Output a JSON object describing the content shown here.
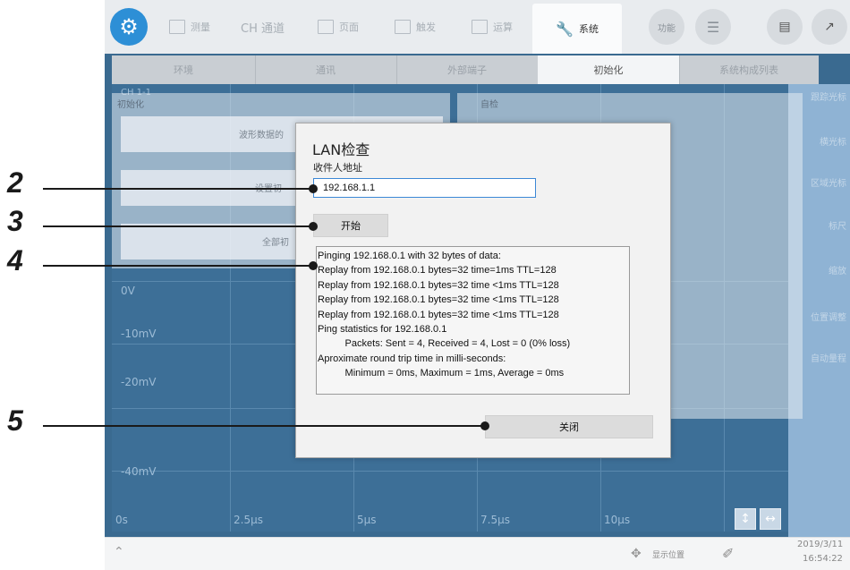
{
  "topbar": {
    "tabs": [
      {
        "label": "测量",
        "icon": "waveform-icon"
      },
      {
        "label": "CH 通道",
        "icon": ""
      },
      {
        "label": "页面",
        "icon": "page-icon"
      },
      {
        "label": "触发",
        "icon": "trigger-icon"
      },
      {
        "label": "运算",
        "icon": "calc-icon"
      }
    ],
    "system_tab": {
      "label": "系统",
      "icon": "wrench-icon"
    },
    "func_button": "功能"
  },
  "subtabs": [
    "环境",
    "通讯",
    "外部端子",
    "初始化",
    "系统构成列表"
  ],
  "graph": {
    "ch_label": "CH 1-1",
    "y_labels": [
      "0V",
      "-10mV",
      "-20mV",
      "-40mV"
    ],
    "x_labels": [
      "0s",
      "2.5μs",
      "5μs",
      "7.5μs",
      "10μs"
    ]
  },
  "right_panel": [
    "跟踪光标",
    "横光标",
    "区域光标",
    "标尺",
    "缩放",
    "位置调整",
    "自动量程"
  ],
  "background_panels": {
    "init_title": "初始化",
    "self_check_title": "自检",
    "btn1": "波形数据的",
    "btn2": "设置初",
    "btn3": "全部初"
  },
  "statusbar": {
    "display_position": "显示位置",
    "date": "2019/3/11",
    "time": "16:54:22"
  },
  "dialog": {
    "title": "LAN检查",
    "address_label": "收件人地址",
    "address_value": "192.168.1.1",
    "start_button": "开始",
    "log": "Pinging 192.168.0.1 with 32 bytes of data:\nReplay from 192.168.0.1 bytes=32 time=1ms TTL=128\nReplay from 192.168.0.1 bytes=32 time <1ms TTL=128\nReplay from 192.168.0.1 bytes=32 time <1ms TTL=128\nReplay from 192.168.0.1 bytes=32 time <1ms TTL=128\nPing statistics for 192.168.0.1\n          Packets: Sent = 4, Received = 4, Lost = 0 (0% loss)\nAproximate round trip time in milli-seconds:\n          Minimum = 0ms, Maximum = 1ms, Average = 0ms",
    "close_button": "关闭"
  },
  "callouts": [
    "2",
    "3",
    "4",
    "5"
  ]
}
